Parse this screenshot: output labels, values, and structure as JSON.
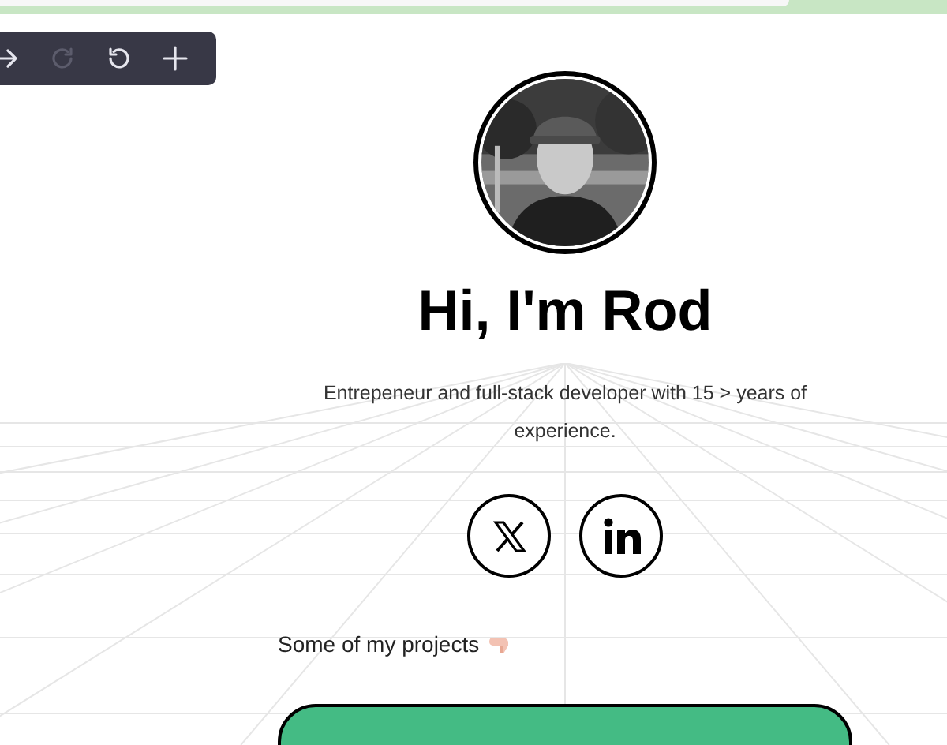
{
  "toolbar": {
    "buttons": [
      {
        "kind": "forward",
        "disabled": false
      },
      {
        "kind": "redo",
        "disabled": true
      },
      {
        "kind": "undo",
        "disabled": false
      },
      {
        "kind": "add",
        "disabled": false
      }
    ]
  },
  "profile": {
    "heading": "Hi, I'm Rod",
    "bio": "Entrepeneur and full-stack developer with 15 > years of experience."
  },
  "social_links": [
    {
      "kind": "x"
    },
    {
      "kind": "linkedin"
    }
  ],
  "projects": {
    "label": "Some of my projects",
    "cards": [
      {
        "kind": "project"
      }
    ]
  }
}
